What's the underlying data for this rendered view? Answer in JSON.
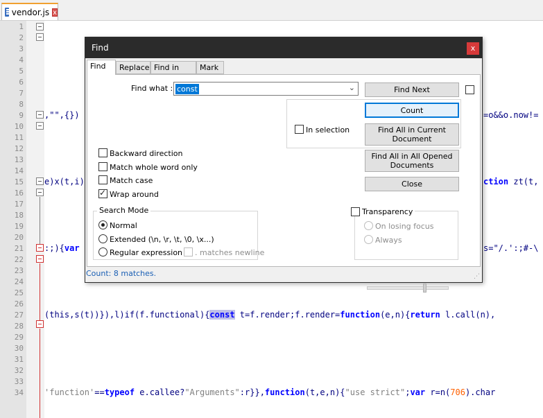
{
  "editor_tab": {
    "filename": "vendor.js",
    "close_glyph": "x"
  },
  "line_numbers": [
    "1",
    "2",
    "3",
    "4",
    "5",
    "6",
    "7",
    "8",
    "9",
    "10",
    "11",
    "12",
    "13",
    "14",
    "15",
    "16",
    "17",
    "18",
    "19",
    "20",
    "21",
    "22",
    "23",
    "24",
    "25",
    "26",
    "27",
    "28",
    "29",
    "30",
    "31",
    "32",
    "33",
    "34"
  ],
  "code": {
    "l9": ",\"\",{})",
    "l9_right": "=o&&o.now!=",
    "l15_a": "e)x(t,i)",
    "l15_b_kw": "ction",
    "l15_b": " zt(t,",
    "l21_a": ":;){",
    "l21_a_kw": "var",
    "l21_b": "s=\"/.':;#-\\",
    "l27_a": "(this,s(t))}),l)if(f.functional){",
    "l27_match": "const",
    "l27_b": " t=f.render;f.render=",
    "l27_kw1": "function",
    "l27_c": "(e,n){",
    "l27_kw2": "return",
    "l27_d": " l.call(n),",
    "l34_str1": "'function'",
    "l34_a": "==",
    "l34_kw1": "typeof",
    "l34_b": " e.callee?",
    "l34_str2": "\"Arguments\"",
    "l34_c": ":r}},",
    "l34_kw2": "function",
    "l34_d": "(t,e,n){",
    "l34_str3": "\"use strict\"",
    "l34_e": ";",
    "l34_kw3": "var",
    "l34_f": " r=n(",
    "l34_num": "706",
    "l34_g": ").char"
  },
  "dialog": {
    "title": "Find",
    "close_glyph": "x",
    "tabs": [
      "Find",
      "Replace",
      "Find in Files",
      "Mark"
    ],
    "find_what_label": "Find what :",
    "find_what_value": "const",
    "buttons": {
      "find_next": "Find Next",
      "count": "Count",
      "find_all_current": "Find All in Current Document",
      "find_all_opened": "Find All in All Opened Documents",
      "close": "Close"
    },
    "in_selection": "In selection",
    "options": {
      "backward": "Backward direction",
      "whole_word": "Match whole word only",
      "match_case": "Match case",
      "wrap_around": "Wrap around"
    },
    "search_mode": {
      "title": "Search Mode",
      "normal": "Normal",
      "extended": "Extended (\\n, \\r, \\t, \\0, \\x...)",
      "regex": "Regular expression",
      "matches_newline": ". matches newline"
    },
    "transparency": {
      "title": "Transparency",
      "on_losing_focus": "On losing focus",
      "always": "Always",
      "level": 0.72
    },
    "status": "Count: 8 matches."
  }
}
